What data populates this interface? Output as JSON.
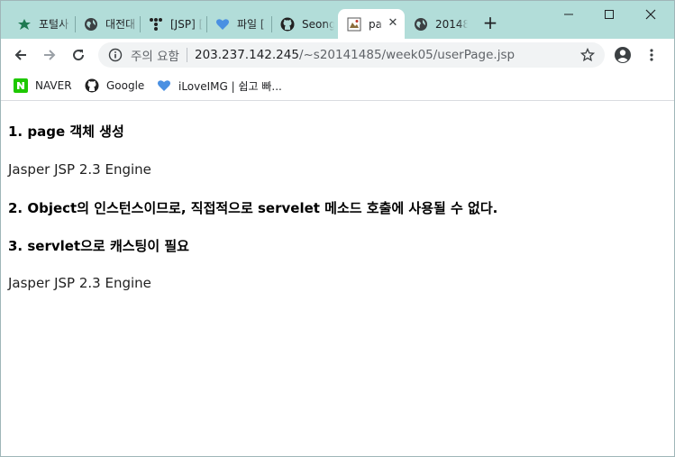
{
  "tabs": [
    {
      "label": "포털사",
      "icon": "naver-cafe-icon",
      "active": false
    },
    {
      "label": "대전대",
      "icon": "globe-icon",
      "active": false
    },
    {
      "label": "[JSP] [",
      "icon": "tistory-icon",
      "active": false
    },
    {
      "label": "파일 [",
      "icon": "ilovimg-heart-icon",
      "active": false
    },
    {
      "label": "Seong",
      "icon": "github-icon",
      "active": false
    },
    {
      "label": "pa",
      "icon": "page-favicon-icon",
      "active": true
    },
    {
      "label": "20148",
      "icon": "globe-icon",
      "active": false
    }
  ],
  "toolbar": {
    "security_label": "주의 요함",
    "url_host": "203.237.142.245",
    "url_path": "/~s20141485/week05/userPage.jsp"
  },
  "bookmarks": [
    {
      "label": "NAVER",
      "icon": "naver-icon"
    },
    {
      "label": "Google",
      "icon": "github-icon"
    },
    {
      "label": "iLoveIMG | 쉽고 빠...",
      "icon": "ilovimg-heart-icon"
    }
  ],
  "content": {
    "line1": "1. page 객체 생성",
    "line2": "Jasper JSP 2.3 Engine",
    "line3": "2. Object의 인스턴스이므로, 직접적으로 servelet 메소드 호출에 사용될 수 없다.",
    "line4": "3. servlet으로 캐스팅이 필요",
    "line5": "Jasper JSP 2.3 Engine"
  },
  "colors": {
    "tabstrip": "#b2ddd9",
    "omnibox": "#f1f3f4"
  }
}
